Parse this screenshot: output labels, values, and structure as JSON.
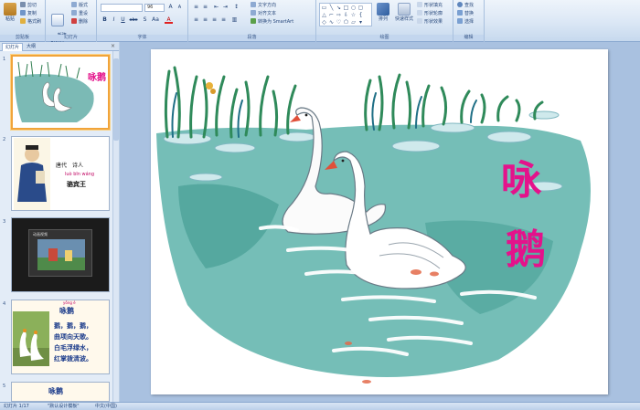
{
  "ribbon": {
    "clipboard": {
      "paste_label": "粘贴",
      "cut_label": "剪切",
      "copy_label": "复制",
      "format_painter_label": "格式刷",
      "group_label": "剪贴板"
    },
    "slides": {
      "new_slide_label": "新建\n幻灯片",
      "layout_label": "版式",
      "reset_label": "重设",
      "delete_label": "删除",
      "group_label": "幻灯片"
    },
    "font": {
      "font_size": "96",
      "bold_label": "B",
      "italic_label": "I",
      "underline_label": "U",
      "strike_label": "abc",
      "shadow_label": "S",
      "case_label": "Aa",
      "color_label": "A",
      "group_label": "字体"
    },
    "paragraph": {
      "text_direction_label": "文字方向",
      "align_text_label": "对齐文本",
      "smartart_label": "转换为 SmartArt",
      "group_label": "段落"
    },
    "drawing": {
      "arrange_label": "排列",
      "quick_styles_label": "快速样式",
      "shape_fill_label": "形状填充",
      "shape_outline_label": "形状轮廓",
      "shape_effects_label": "形状效果",
      "group_label": "绘图"
    },
    "editing": {
      "find_label": "查找",
      "replace_label": "替换",
      "select_label": "选择",
      "group_label": "编辑"
    }
  },
  "panel": {
    "tab_slides": "幻灯片",
    "tab_outline": "大纲",
    "close_icon": "×",
    "slides": [
      {
        "num": "1",
        "title": "咏鹅"
      },
      {
        "num": "2",
        "dynasty": "唐代　诗人",
        "pinyin": "luò bīn wáng",
        "author": "骆宾王"
      },
      {
        "num": "3",
        "caption": "动画视频"
      },
      {
        "num": "4",
        "pinyin_title": "yǒng é",
        "title": "咏鹅",
        "lines": [
          "鹅，鹅，鹅，",
          "曲项向天歌。",
          "白毛浮绿水，",
          "红掌拨清波。"
        ]
      },
      {
        "num": "5",
        "title": "咏鹅"
      }
    ]
  },
  "slide": {
    "title_char_1": "咏",
    "title_char_2": "鹅"
  },
  "status": {
    "slide_counter": "幻灯片 1/17",
    "theme": "\"默认设计模板\"",
    "language": "中文(中国)"
  }
}
